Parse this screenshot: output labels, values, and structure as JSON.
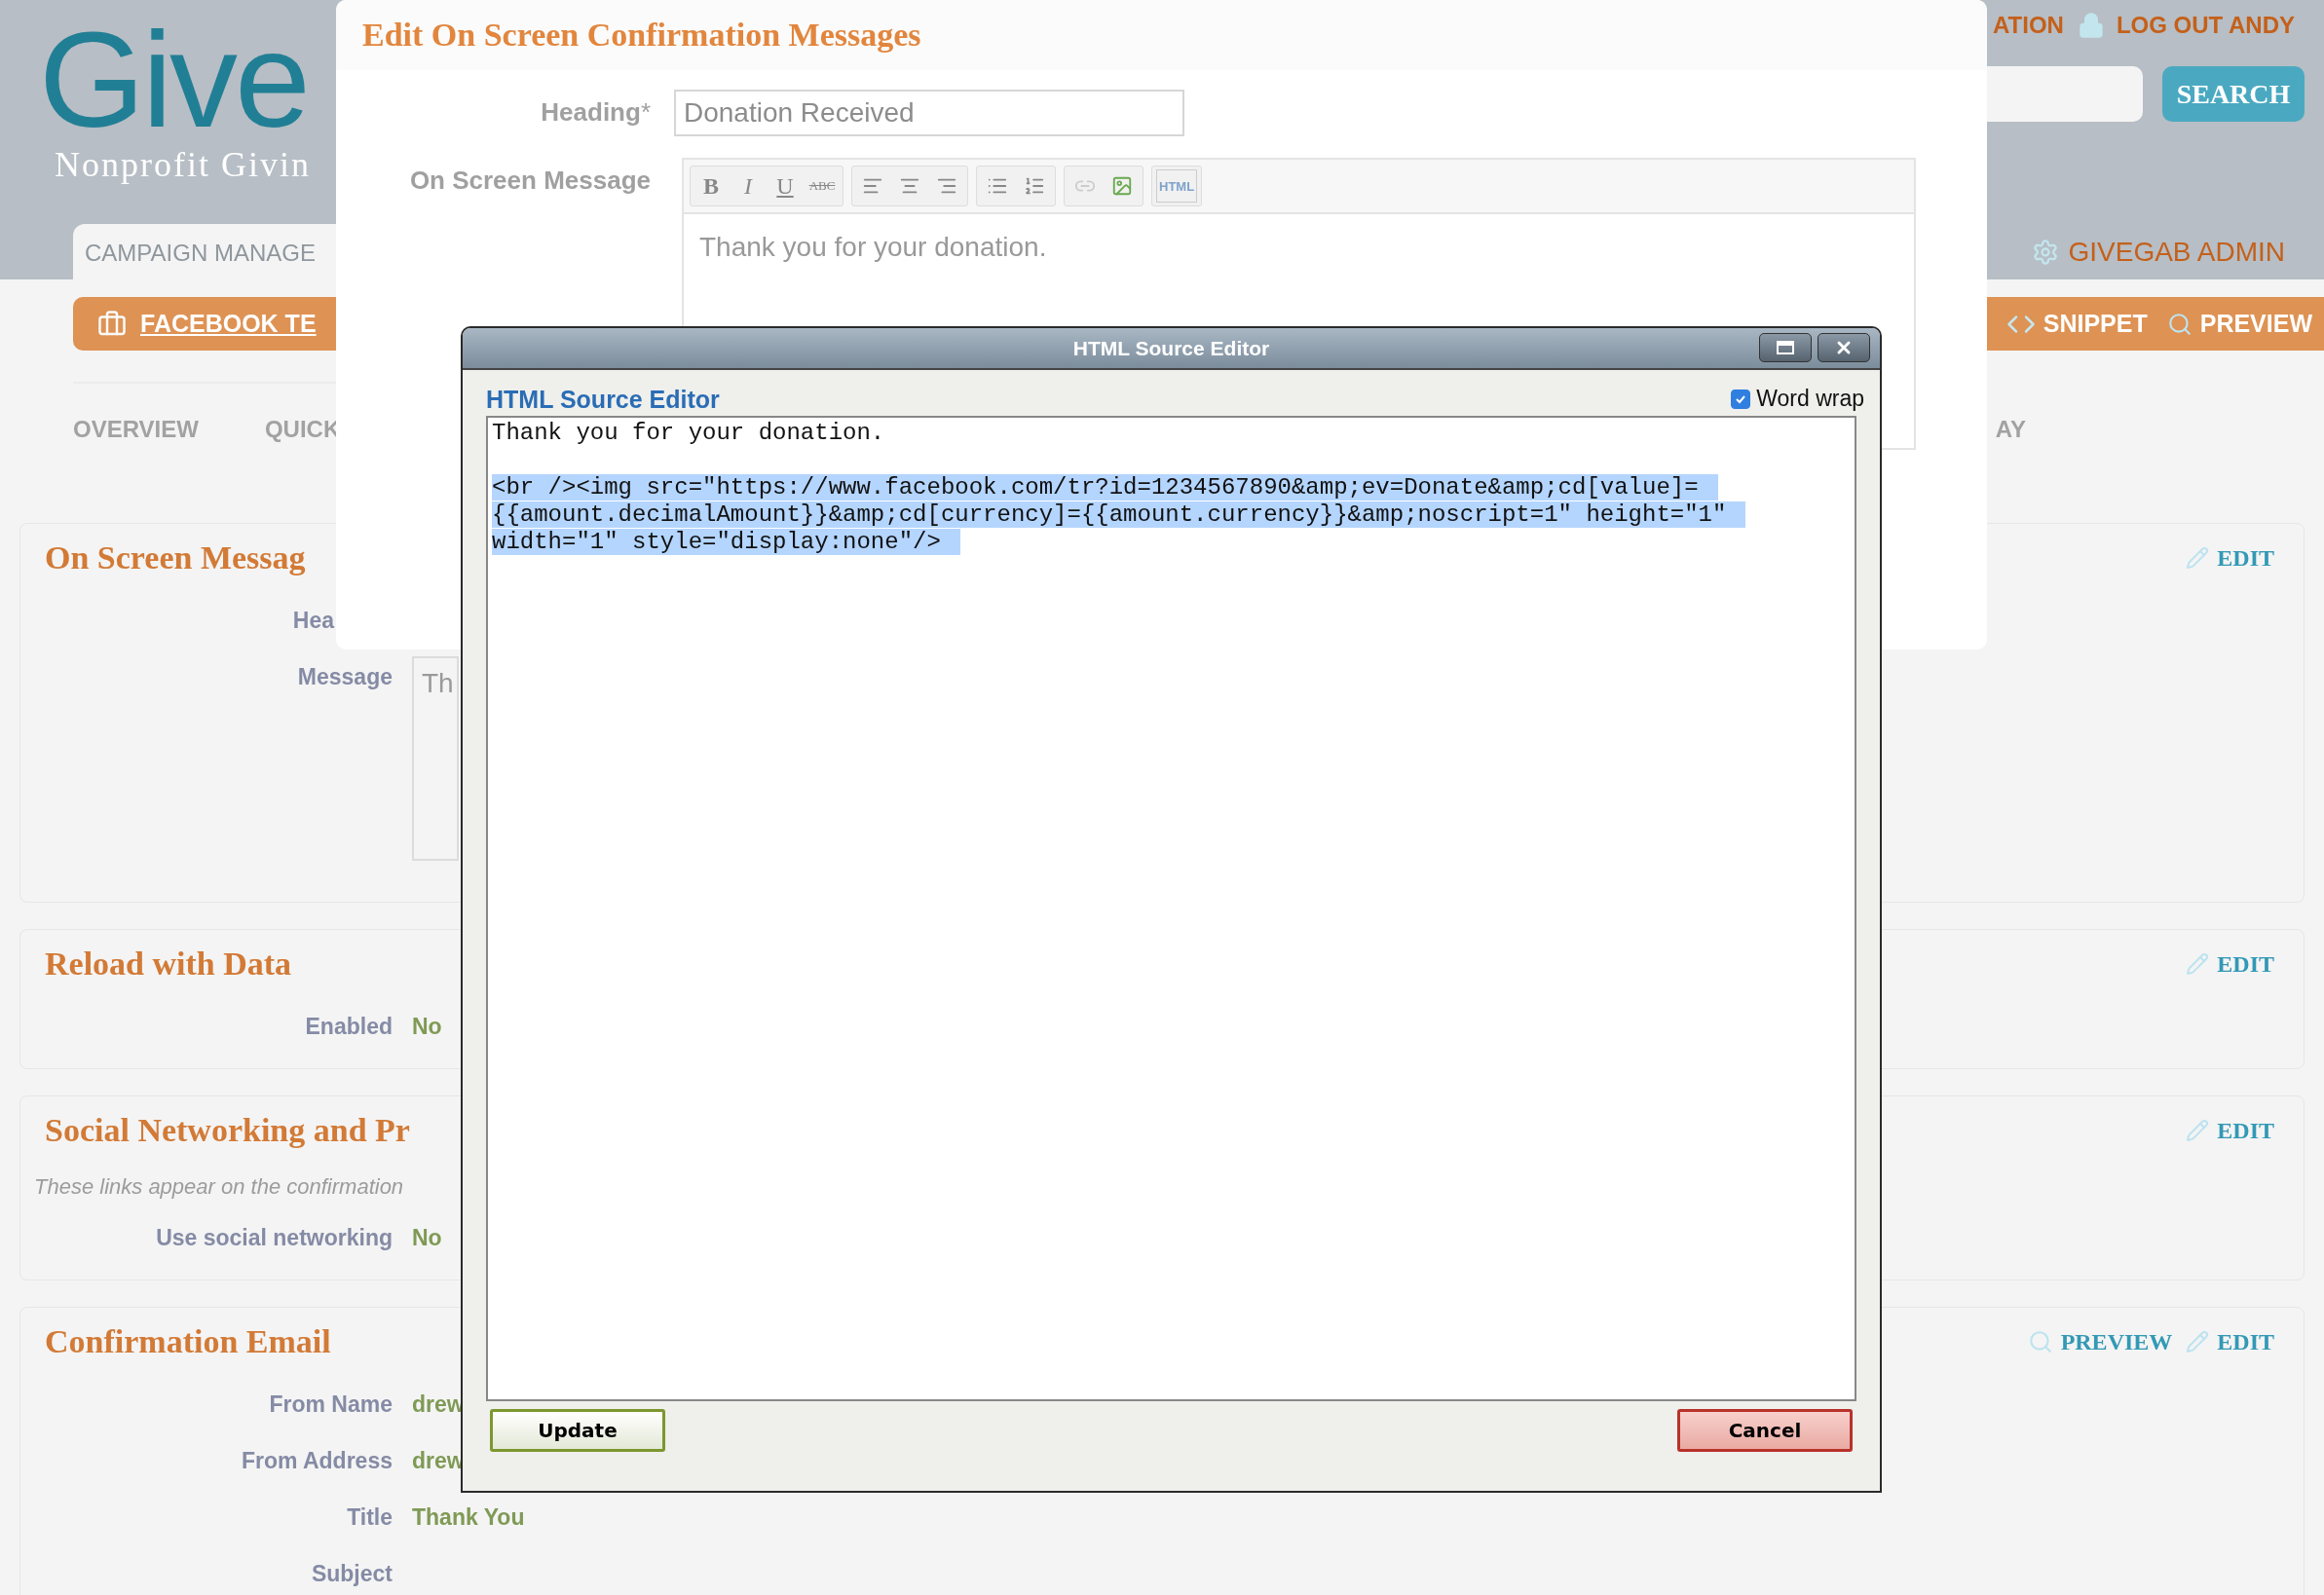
{
  "header": {
    "logo": "Give",
    "tagline": "Nonprofit Givin",
    "tab": "CAMPAIGN MANAGE",
    "top_links": [
      {
        "kind": "text",
        "label": "ATION"
      },
      {
        "kind": "lock",
        "label": "LOG OUT ANDY"
      }
    ],
    "search_button": "SEARCH",
    "admin_link": "GIVEGAB ADMIN"
  },
  "campaign_bar": {
    "title": "FACEBOOK TE",
    "actions": [
      {
        "kind": "snippet",
        "label": "SNIPPET"
      },
      {
        "kind": "preview",
        "label": "PREVIEW"
      }
    ]
  },
  "nav": {
    "left": [
      "OVERVIEW",
      "QUICK"
    ],
    "right": "AY"
  },
  "sections": [
    {
      "title": "On Screen Messag",
      "actions": [
        {
          "kind": "edit",
          "label": "EDIT"
        }
      ],
      "fields": [
        {
          "label": "Hea"
        },
        {
          "label": "Message",
          "kind": "textarea",
          "value": "Th"
        }
      ]
    },
    {
      "title": "Reload with Data",
      "actions": [
        {
          "kind": "edit",
          "label": "EDIT"
        }
      ],
      "fields": [
        {
          "label": "Enabled",
          "kind": "text",
          "value": "No"
        }
      ]
    },
    {
      "title": "Social Networking and Pr",
      "note": "These links appear on the confirmation",
      "actions": [
        {
          "kind": "edit",
          "label": "EDIT"
        }
      ],
      "fields": [
        {
          "label": "Use social networking",
          "kind": "text",
          "value": "No"
        }
      ]
    },
    {
      "title": "Confirmation Email",
      "actions": [
        {
          "kind": "preview",
          "label": "PREVIEW"
        },
        {
          "kind": "edit",
          "label": "EDIT"
        }
      ],
      "fields": [
        {
          "label": "From Name",
          "kind": "text",
          "value": "drew"
        },
        {
          "label": "From Address",
          "kind": "text",
          "value": "drew"
        },
        {
          "label": "Title",
          "kind": "text",
          "value": "Thank You"
        },
        {
          "label": "Subject"
        }
      ]
    }
  ],
  "dialog": {
    "title": "Edit On Screen Confirmation Messages",
    "heading_label": "Heading",
    "required_mark": "*",
    "heading_value": "Donation Received",
    "message_label": "On Screen Message",
    "toolbar": [
      [
        {
          "kind": "bold",
          "label": "B"
        },
        {
          "kind": "italic",
          "label": "I"
        },
        {
          "kind": "underline",
          "label": "U"
        },
        {
          "kind": "strike",
          "label": "ABC"
        }
      ],
      [
        {
          "kind": "align-left"
        },
        {
          "kind": "align-center"
        },
        {
          "kind": "align-right"
        }
      ],
      [
        {
          "kind": "bullet-list"
        },
        {
          "kind": "number-list"
        }
      ],
      [
        {
          "kind": "link",
          "disabled": true
        },
        {
          "kind": "image",
          "disabled": false
        }
      ],
      [
        {
          "kind": "html",
          "label": "HTML"
        }
      ]
    ],
    "message": "Thank you for your donation."
  },
  "modal": {
    "title": "HTML Source Editor",
    "heading": "HTML Source Editor",
    "word_wrap": {
      "label": "Word wrap",
      "checked": true
    },
    "source": {
      "plain_lines": [
        "Thank you for your donation."
      ],
      "selected_lines": [
        "<br /><img src=\"https://www.facebook.com/tr?id=1234567890&amp;ev=Donate&amp;cd[value]=",
        "{{amount.decimalAmount}}&amp;cd[currency]={{amount.currency}}&amp;noscript=1\" height=\"1\"",
        "width=\"1\" style=\"display:none\"/>"
      ]
    },
    "buttons": [
      {
        "kind": "confirm",
        "label": "Update"
      },
      {
        "kind": "cancel",
        "label": "Cancel"
      }
    ]
  }
}
